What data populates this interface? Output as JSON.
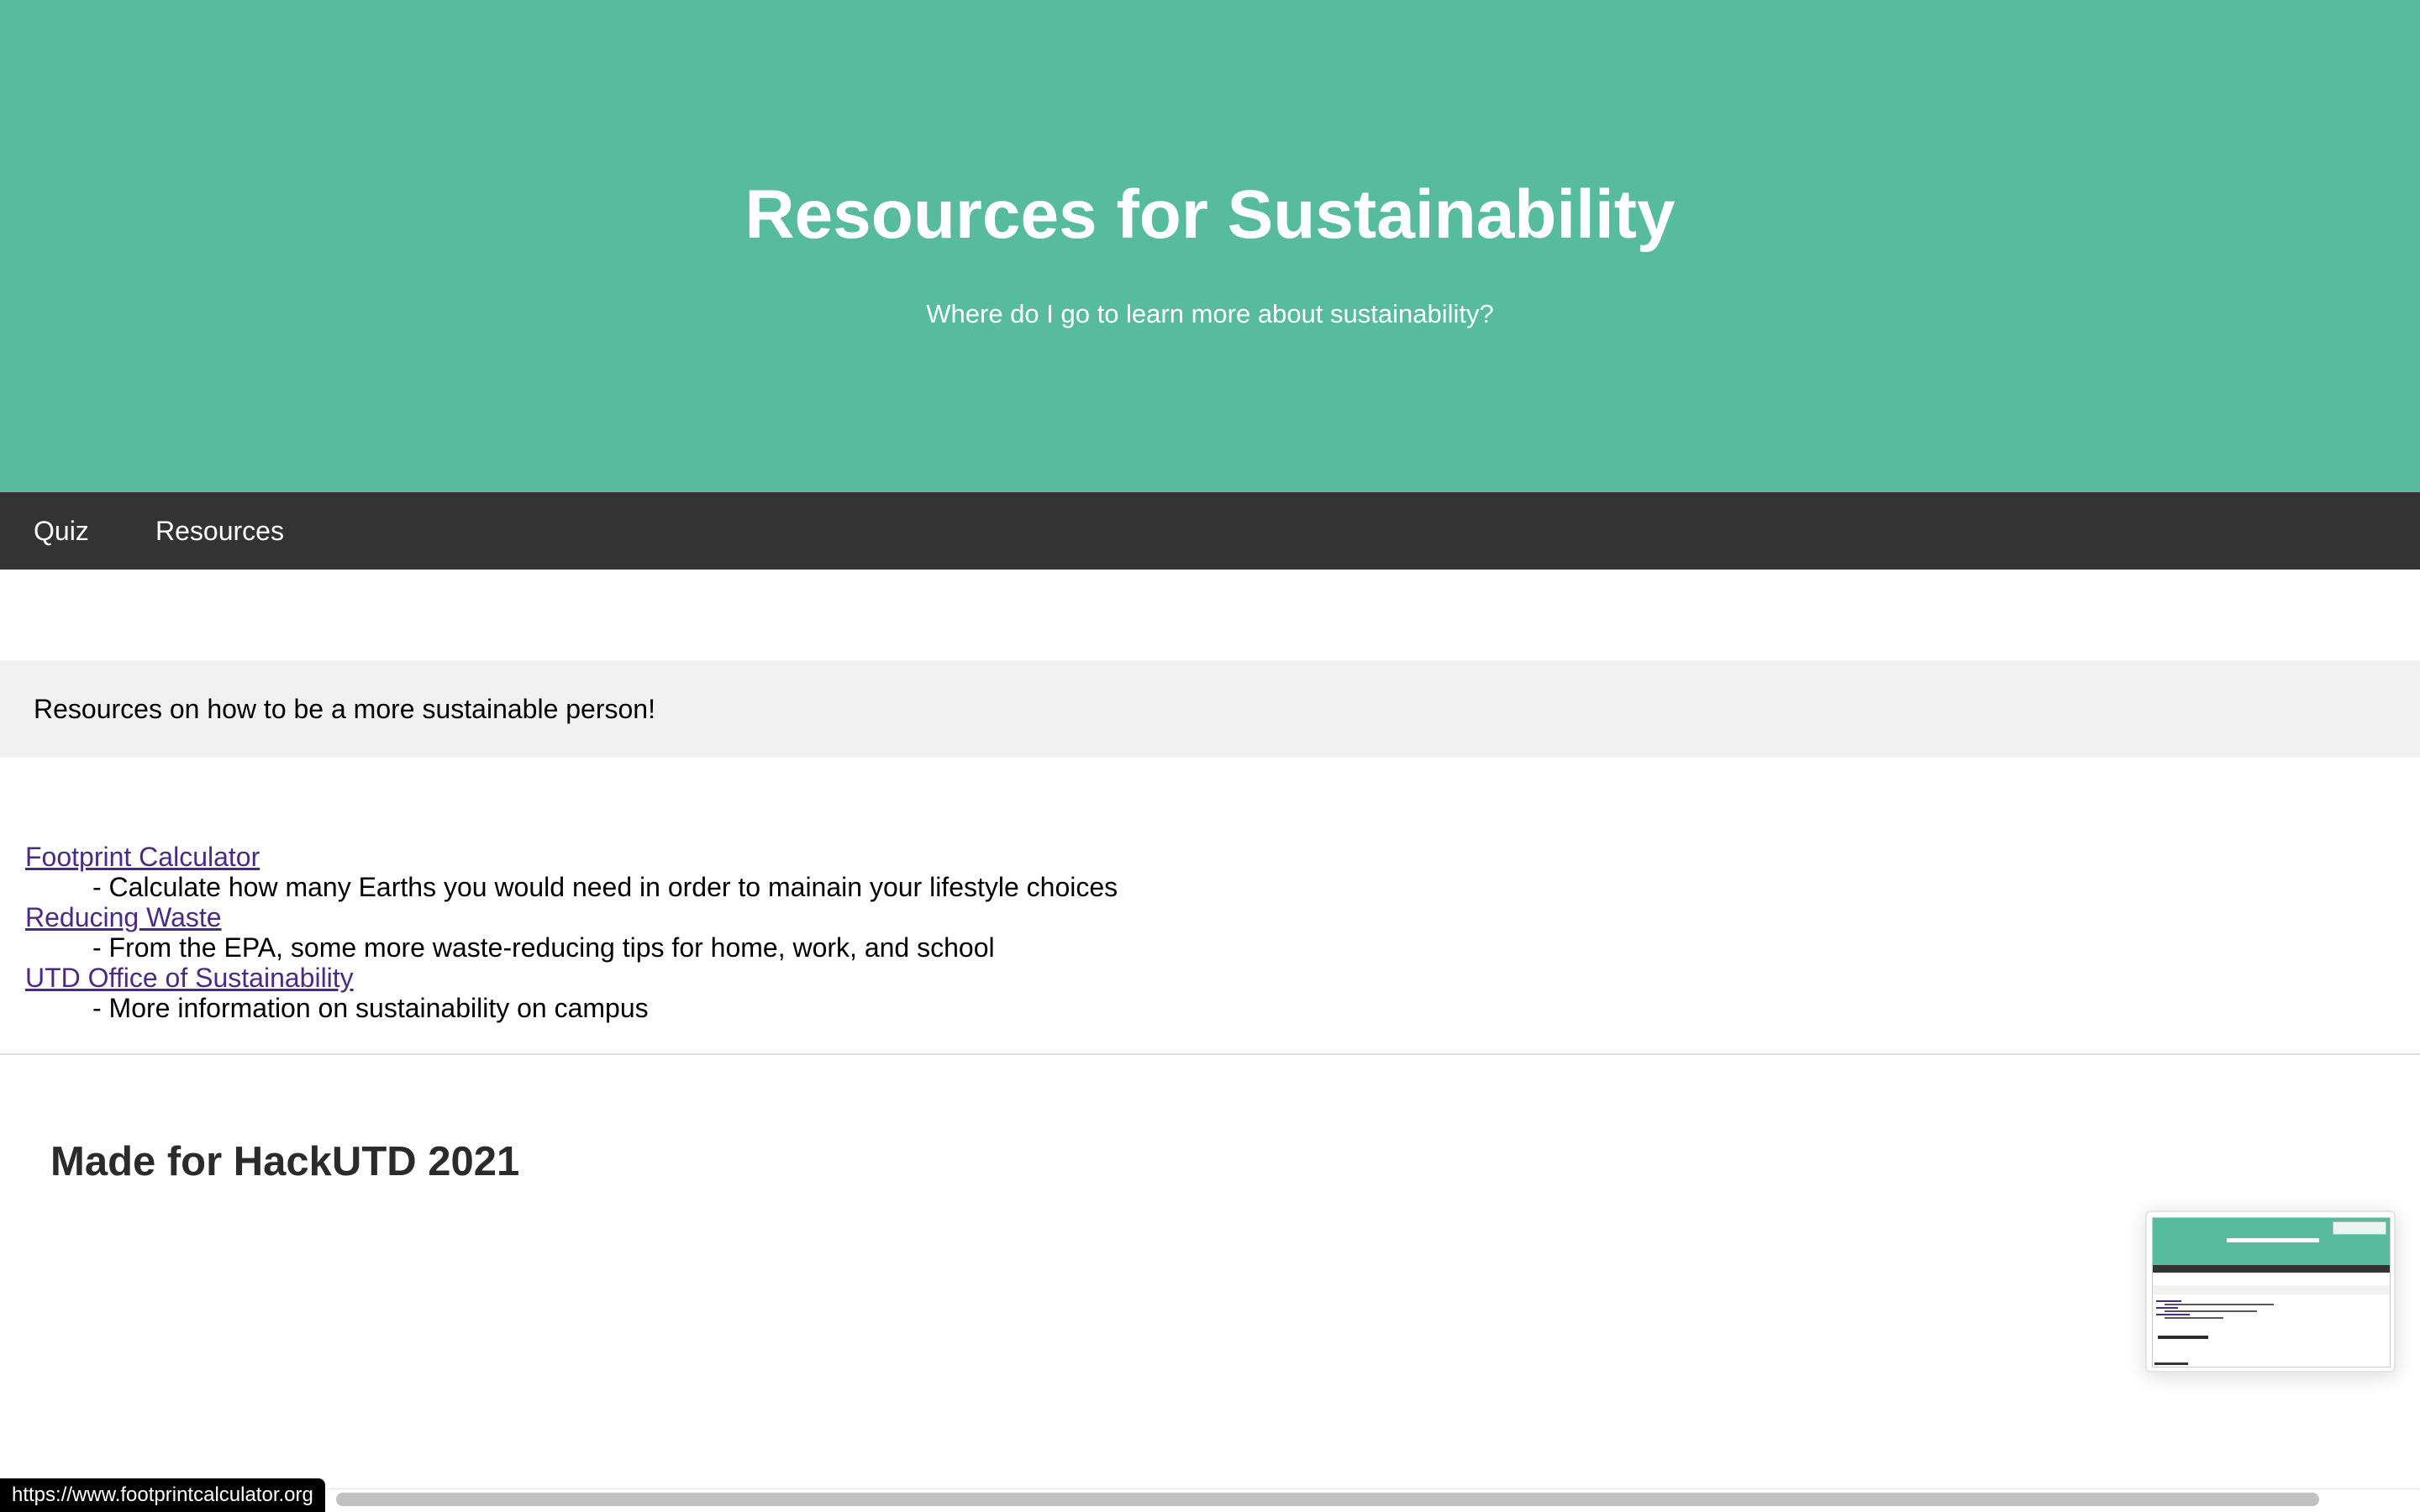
{
  "header": {
    "title": "Resources for Sustainability",
    "subtitle": "Where do I go to learn more about sustainability?"
  },
  "nav": {
    "items": [
      {
        "label": "Quiz"
      },
      {
        "label": "Resources"
      }
    ]
  },
  "intro": {
    "text": "Resources on how to be a more sustainable person!"
  },
  "resources": [
    {
      "link": "Footprint Calculator",
      "description": "- Calculate how many Earths you would need in order to mainain your lifestyle choices"
    },
    {
      "link": "Reducing Waste",
      "description": "- From the EPA, some more waste-reducing tips for home, work, and school"
    },
    {
      "link": "UTD Office of Sustainability",
      "description": "- More information on sustainability on campus"
    }
  ],
  "footer": {
    "heading": "Made for HackUTD 2021"
  },
  "status_bar": {
    "url": "https://www.footprintcalculator.org"
  },
  "colors": {
    "header_bg": "#57bb9e",
    "nav_bg": "#333333",
    "link": "#4b2a86",
    "intro_bg": "#f1f1f1"
  }
}
